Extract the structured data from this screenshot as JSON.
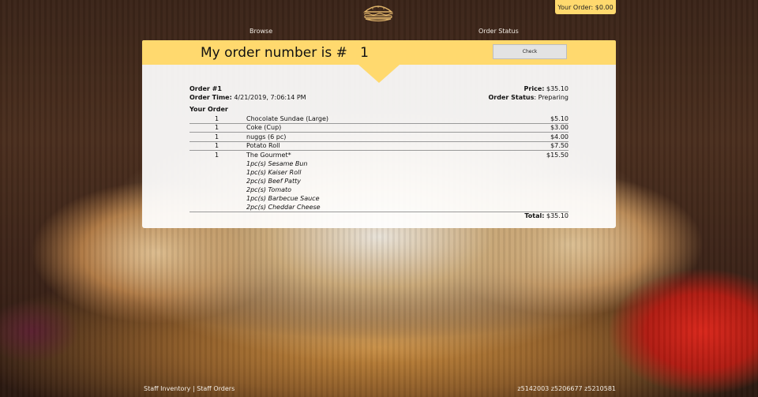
{
  "header": {
    "logo_icon": "burger-icon",
    "wallet_label": "Your Order: $0.00",
    "nav": {
      "browse": "Browse",
      "order_status": "Order Status"
    }
  },
  "banner": {
    "title_prefix": "My order number is #",
    "order_number_value": "1",
    "check_label": "Check"
  },
  "order": {
    "id_text": "Order #1",
    "time_label": "Order Time:",
    "time_value": "4/21/2019, 7:06:14 PM",
    "price_label": "Price:",
    "price_value": "$35.10",
    "status_label": "Order Status",
    "status_value": ": Preparing",
    "your_order_label": "Your Order",
    "items": [
      {
        "qty": "1",
        "name": "Chocolate Sundae (Large)",
        "price": "$5.10"
      },
      {
        "qty": "1",
        "name": "Coke (Cup)",
        "price": "$3.00"
      },
      {
        "qty": "1",
        "name": "nuggs (6 pc)",
        "price": "$4.00"
      },
      {
        "qty": "1",
        "name": "Potato Roll",
        "price": "$7.50"
      },
      {
        "qty": "1",
        "name": "The Gourmet*",
        "price": "$15.50"
      }
    ],
    "components": [
      "1pc(s) Sesame Bun",
      "1pc(s) Kaiser Roll",
      "2pc(s) Beef Patty",
      "2pc(s) Tomato",
      "1pc(s) Barbecue Sauce",
      "2pc(s) Cheddar Cheese"
    ],
    "total_label": "Total:",
    "total_value": "$35.10"
  },
  "footer": {
    "staff_inventory": "Staff Inventory",
    "separator": "|",
    "staff_orders": "Staff Orders",
    "student_ids": "z5142003 z5206677 z5210581"
  },
  "colors": {
    "accent": "#ffd96e",
    "panel": "#ffffff"
  }
}
